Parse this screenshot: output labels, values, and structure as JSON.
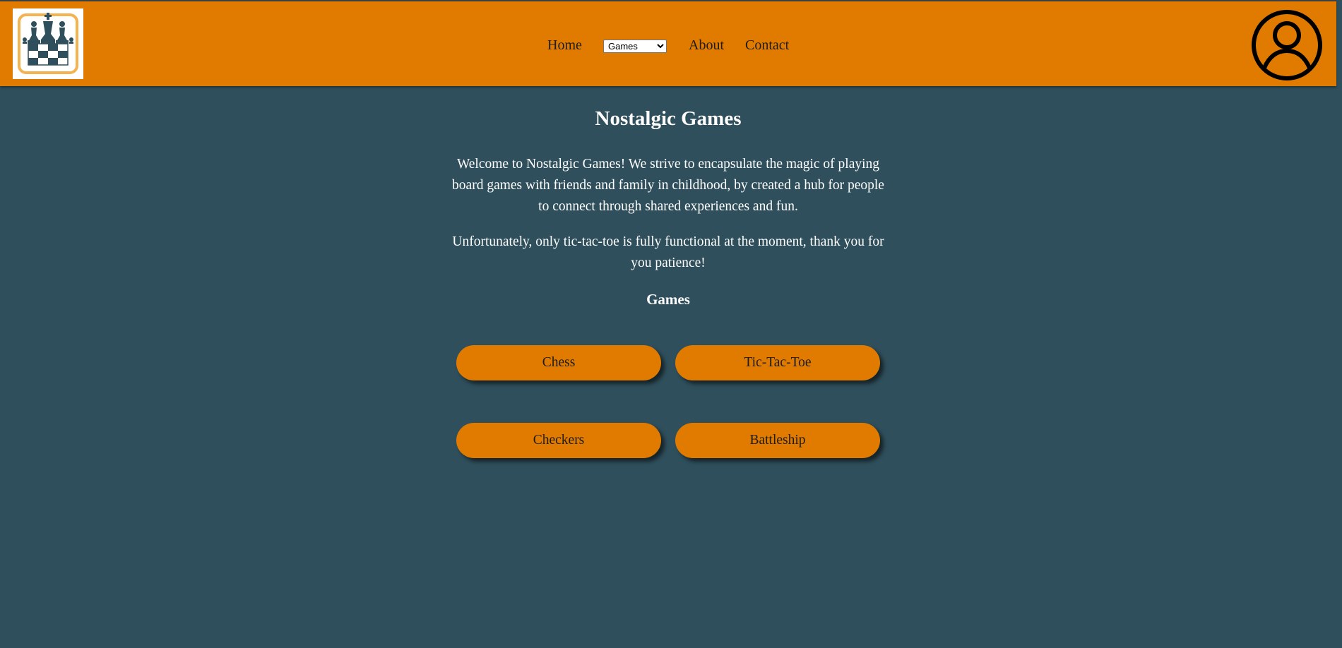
{
  "nav": {
    "logo_icon": "chess-pieces-board-logo",
    "links": {
      "home": "Home",
      "about": "About",
      "contact": "Contact"
    },
    "games_select": {
      "selected": "Games"
    },
    "user_icon": "user-profile-icon"
  },
  "main": {
    "title": "Nostalgic Games",
    "intro": "Welcome to Nostalgic Games! We strive to encapsulate the magic of playing board games with friends and family in childhood, by created a hub for people to connect through shared experiences and fun.",
    "notice": "Unfortunately, only tic-tac-toe is fully functional at the moment, thank you for you patience!",
    "games_heading": "Games",
    "games": {
      "chess": "Chess",
      "tictactoe": "Tic-Tac-Toe",
      "checkers": "Checkers",
      "battleship": "Battleship"
    }
  },
  "colors": {
    "accent": "#e07b00",
    "background": "#2f4f5c",
    "text_light": "#ffffff",
    "text_dark": "#1c1c1c"
  }
}
